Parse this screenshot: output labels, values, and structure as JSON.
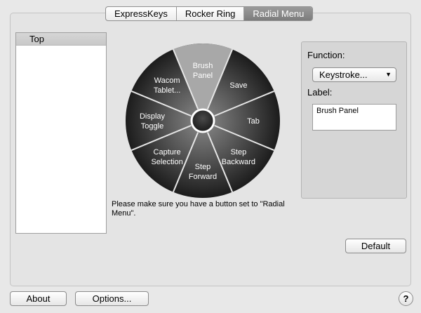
{
  "tabs": [
    {
      "label": "ExpressKeys",
      "selected": false
    },
    {
      "label": "Rocker Ring",
      "selected": false
    },
    {
      "label": "Radial Menu",
      "selected": true
    }
  ],
  "tree": {
    "items": [
      {
        "label": "Top",
        "selected": true
      }
    ]
  },
  "radial_menu": {
    "segments": [
      {
        "label_lines": [
          "Brush",
          "Panel"
        ],
        "selected": true
      },
      {
        "label_lines": [
          "Save"
        ]
      },
      {
        "label_lines": [
          "Tab"
        ]
      },
      {
        "label_lines": [
          "Step",
          "Backward"
        ]
      },
      {
        "label_lines": [
          "Step",
          "Forward"
        ]
      },
      {
        "label_lines": [
          "Capture",
          "Selection"
        ]
      },
      {
        "label_lines": [
          "Display",
          "Toggle"
        ]
      },
      {
        "label_lines": [
          "Wacom",
          "Tablet..."
        ]
      }
    ]
  },
  "note": {
    "text": "Please make sure you have a button set to \"Radial Menu\"."
  },
  "function_panel": {
    "function_label": "Function:",
    "function_value": "Keystroke...",
    "label_label": "Label:",
    "label_value": "Brush Panel"
  },
  "buttons": {
    "default": "Default",
    "about": "About",
    "options": "Options...",
    "help": "?"
  },
  "colors": {
    "wheel_outer": "#1c1c1c",
    "wheel_inner": "#9a9a9a",
    "selected_segment": "#a8a8a8"
  }
}
